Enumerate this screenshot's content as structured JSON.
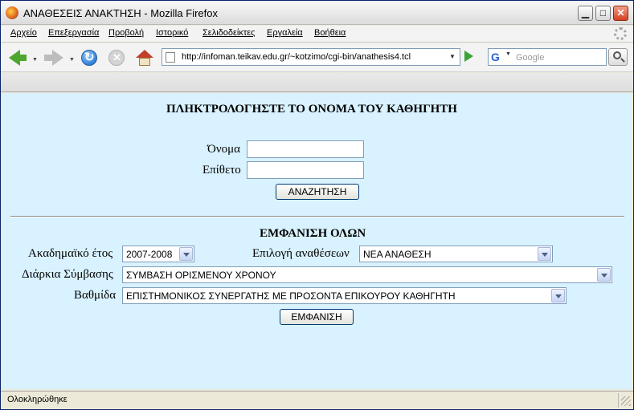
{
  "window": {
    "title": "ΑΝΑΘΕΣΕΙΣ ΑΝΑΚΤΗΣΗ - Mozilla Firefox",
    "minimize": "▁",
    "maximize": "□",
    "close": "✕"
  },
  "menu": {
    "items": [
      "Αρχείο",
      "Επεξεργασία",
      "Προβολή",
      "Ιστορικό",
      "Σελιδοδείκτες",
      "Εργαλεία",
      "Βοήθεια"
    ]
  },
  "navigation": {
    "url": "http://infoman.teikav.edu.gr/~kotzimo/cgi-bin/anathesis4.tcl",
    "search_engine_icon": "G",
    "search_placeholder": "Google",
    "icons": [
      "back-icon",
      "forward-icon",
      "reload-icon",
      "stop-icon",
      "home-icon",
      "go-icon",
      "search-icon"
    ]
  },
  "search_form": {
    "heading": "ΠΛΗΚΤΡΟΛΟΓΗΣΤΕ ΤΟ ΟΝΟΜΑ ΤΟΥ ΚΑΘΗΓΗΤΗ",
    "first_name_label": "Όνομα",
    "first_name_value": "",
    "last_name_label": "Επίθετο",
    "last_name_value": "",
    "submit_label": "ΑΝΑΖΗΤΗΣΗ"
  },
  "show_all_form": {
    "heading": "ΕΜΦΑΝΙΣΗ ΟΛΩΝ",
    "academic_year_label": "Ακαδημαϊκό έτος",
    "academic_year_value": "2007-2008",
    "assignment_label": "Επιλογή αναθέσεων",
    "assignment_value": "ΝΕΑ ΑΝΑΘΕΣΗ",
    "contract_label": "Διάρκια Σύμβασης",
    "contract_value": "ΣΥΜΒΑΣΗ ΟΡΙΣΜΕΝΟΥ ΧΡΟΝΟΥ",
    "rank_label": "Βαθμίδα",
    "rank_value": "ΕΠΙΣΤΗΜΟΝΙΚΟΣ ΣΥΝΕΡΓΑΤΗΣ ΜΕ ΠΡΟΣΟΝΤΑ ΕΠΙΚΟΥΡΟΥ ΚΑΘΗΓΗΤΗ",
    "submit_label": "ΕΜΦΑΝΙΣΗ"
  },
  "status": {
    "text": "Ολοκληρώθηκε"
  }
}
